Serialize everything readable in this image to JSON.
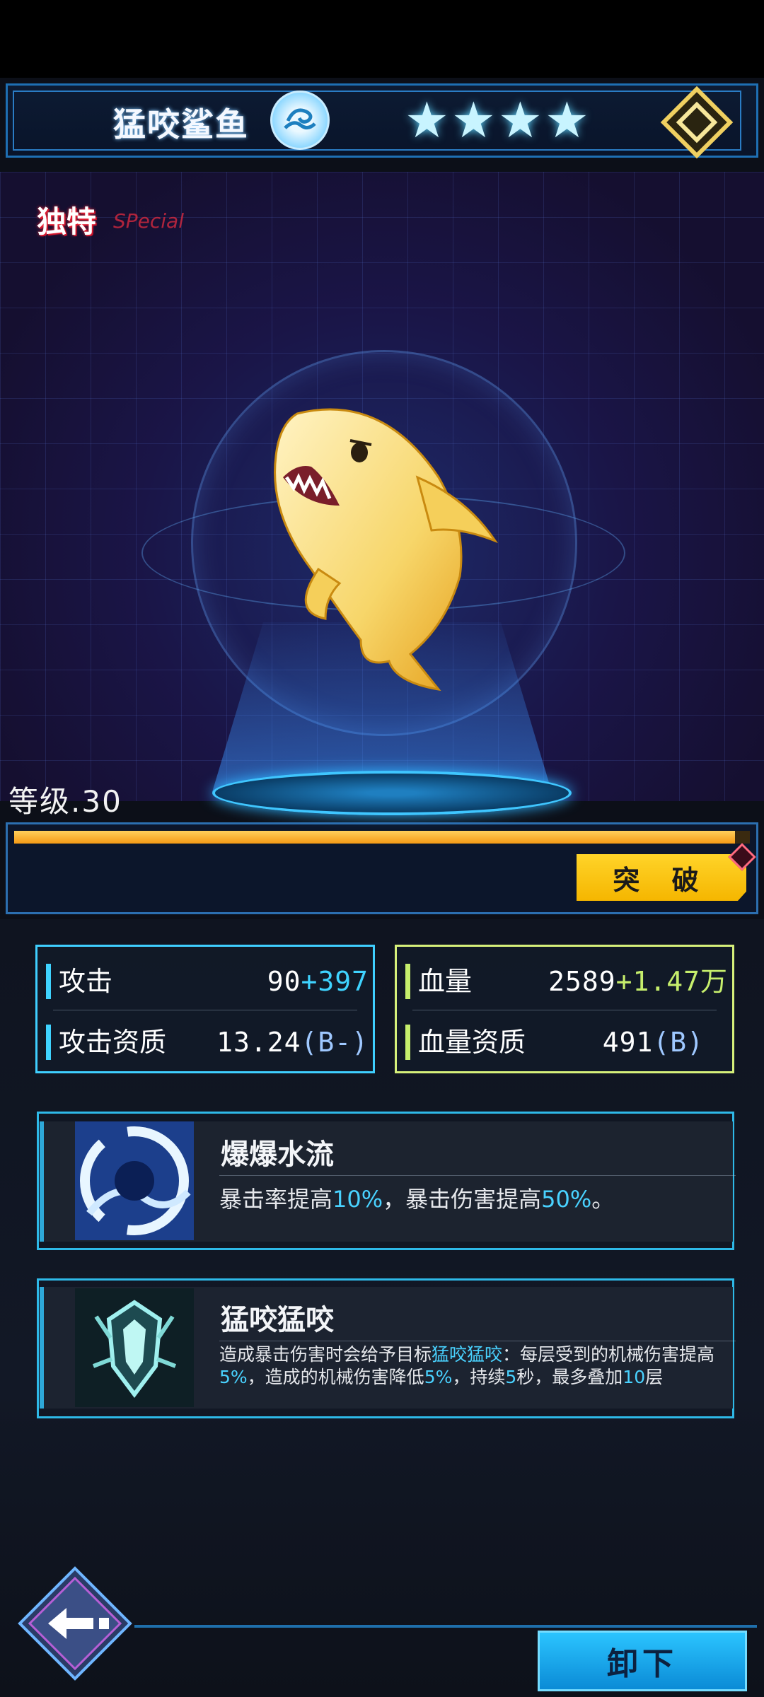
{
  "header": {
    "pet_name": "猛咬鲨鱼",
    "stars": 4,
    "element_icon": "water-wave-icon",
    "rank_icon": "gold-diamond-rank-icon"
  },
  "hero": {
    "rarity_tag": "独特",
    "rarity_tag_en": "SPecial"
  },
  "level": {
    "label": "等级.30",
    "exp_fraction": 0.98,
    "break_button": "突 破"
  },
  "stats": {
    "attack": {
      "name": "攻击",
      "base": "90",
      "bonus": "+397"
    },
    "attack_quality": {
      "name": "攻击资质",
      "value": "13.24",
      "grade": "(B-)"
    },
    "hp": {
      "name": "血量",
      "base": "2589",
      "bonus": "+1.47万"
    },
    "hp_quality": {
      "name": "血量资质",
      "value": "491",
      "grade": "(B)"
    }
  },
  "skills": [
    {
      "title": "爆爆水流",
      "desc_parts": [
        "暴击率提高",
        "10%",
        "，暴击伤害提高",
        "50%",
        "。"
      ]
    },
    {
      "title": "猛咬猛咬",
      "desc_parts": [
        "造成暴击伤害时会给予目标",
        "猛咬猛咬",
        "：每层受到的机械伤害提高",
        "5%",
        "，造成的机械伤害降低",
        "5%",
        "，持续",
        "5",
        "秒，最多叠加",
        "10",
        "层"
      ]
    }
  ],
  "footer": {
    "back_icon": "back-arrow-icon",
    "unload_button": "卸下"
  },
  "colors": {
    "accent_cyan": "#3fcfff",
    "accent_lime": "#d6f07a",
    "exp_orange": "#f59a15",
    "button_yellow": "#ffd429",
    "button_blue": "#2bc4ff"
  }
}
